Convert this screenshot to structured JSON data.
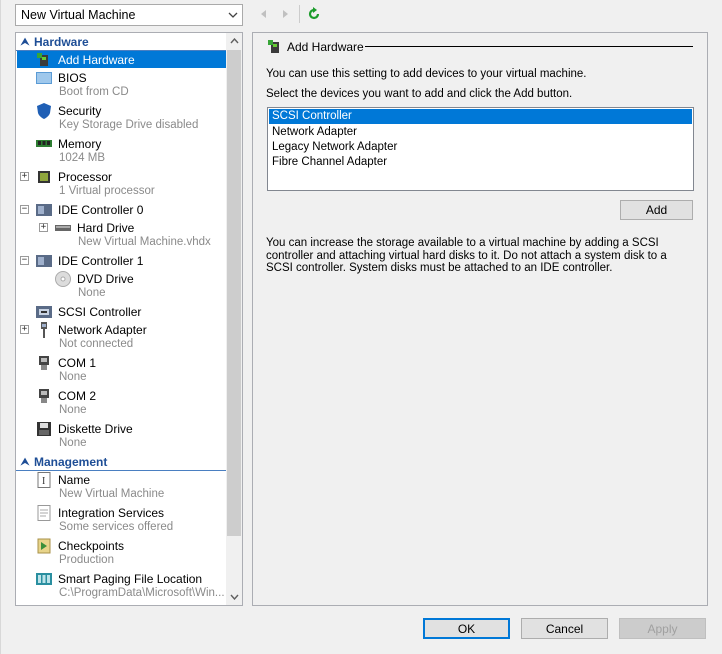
{
  "vm_selector": {
    "value": "New Virtual Machine"
  },
  "toolbar": {
    "back_icon": "back-arrow-icon",
    "forward_icon": "forward-arrow-icon",
    "refresh_icon": "refresh-icon"
  },
  "tree": {
    "hardware_header": "Hardware",
    "management_header": "Management",
    "items": [
      {
        "label": "Add Hardware",
        "sub": ""
      },
      {
        "label": "BIOS",
        "sub": "Boot from CD"
      },
      {
        "label": "Security",
        "sub": "Key Storage Drive disabled"
      },
      {
        "label": "Memory",
        "sub": "1024 MB"
      },
      {
        "label": "Processor",
        "sub": "1 Virtual processor"
      },
      {
        "label": "IDE Controller 0",
        "sub": ""
      },
      {
        "label": "Hard Drive",
        "sub": "New Virtual Machine.vhdx"
      },
      {
        "label": "IDE Controller 1",
        "sub": ""
      },
      {
        "label": "DVD Drive",
        "sub": "None"
      },
      {
        "label": "SCSI Controller",
        "sub": ""
      },
      {
        "label": "Network Adapter",
        "sub": "Not connected"
      },
      {
        "label": "COM 1",
        "sub": "None"
      },
      {
        "label": "COM 2",
        "sub": "None"
      },
      {
        "label": "Diskette Drive",
        "sub": "None"
      },
      {
        "label": "Name",
        "sub": "New Virtual Machine"
      },
      {
        "label": "Integration Services",
        "sub": "Some services offered"
      },
      {
        "label": "Checkpoints",
        "sub": "Production"
      },
      {
        "label": "Smart Paging File Location",
        "sub": "C:\\ProgramData\\Microsoft\\Win..."
      }
    ]
  },
  "right_panel": {
    "title": "Add Hardware",
    "intro": "You can use this setting to add devices to your virtual machine.",
    "instruction": "Select the devices you want to add and click the Add button.",
    "devices": [
      "SCSI Controller",
      "Network Adapter",
      "Legacy Network Adapter",
      "Fibre Channel Adapter"
    ],
    "selected_device": "SCSI Controller",
    "add_button": "Add",
    "description": "You can increase the storage available to a virtual machine by adding a SCSI controller and attaching virtual hard disks to it. Do not attach a system disk to a SCSI controller. System disks must be attached to an IDE controller."
  },
  "footer": {
    "ok": "OK",
    "cancel": "Cancel",
    "apply": "Apply"
  },
  "colors": {
    "selection": "#0078d7",
    "section_header": "#1e4e96"
  }
}
